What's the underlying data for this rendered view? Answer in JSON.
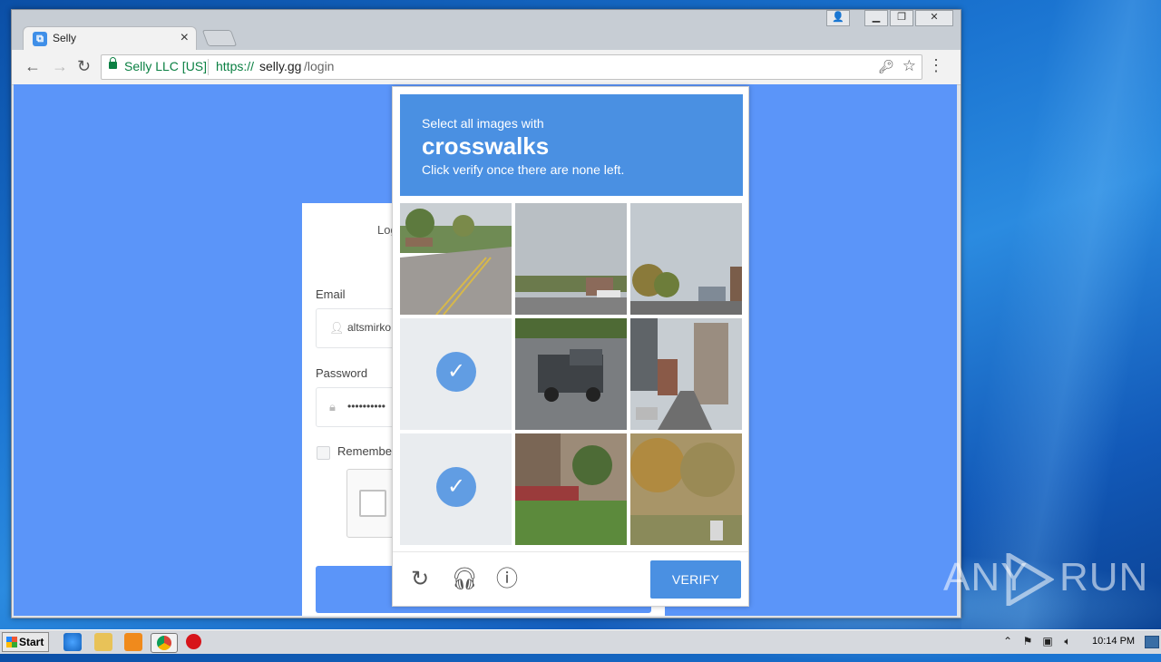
{
  "browser": {
    "tab": {
      "title": "Selly"
    },
    "address": {
      "site_identity": "Selly LLC [US]",
      "url_scheme": "https://",
      "url_host": "selly.gg",
      "url_path": "/login"
    }
  },
  "page": {
    "login_title": "Log",
    "email_label": "Email",
    "email_value": "altsmirko",
    "password_label": "Password",
    "password_value": "••••••••••",
    "remember_label": "Remember"
  },
  "captcha": {
    "line1": "Select all images with",
    "keyword": "crosswalks",
    "line3": "Click verify once there are none left.",
    "verify_label": "VERIFY",
    "tiles": [
      {
        "index": 1,
        "selected": false
      },
      {
        "index": 2,
        "selected": false
      },
      {
        "index": 3,
        "selected": false
      },
      {
        "index": 4,
        "selected": true
      },
      {
        "index": 5,
        "selected": false
      },
      {
        "index": 6,
        "selected": false
      },
      {
        "index": 7,
        "selected": true
      },
      {
        "index": 8,
        "selected": false
      },
      {
        "index": 9,
        "selected": false
      }
    ]
  },
  "watermark": {
    "left": "ANY",
    "right": "RUN"
  },
  "taskbar": {
    "start_label": "Start",
    "clock": "10:14 PM"
  },
  "colors": {
    "page_bg": "#5b95f9",
    "captcha_accent": "#4a90e2",
    "secure_green": "#0b8043"
  }
}
